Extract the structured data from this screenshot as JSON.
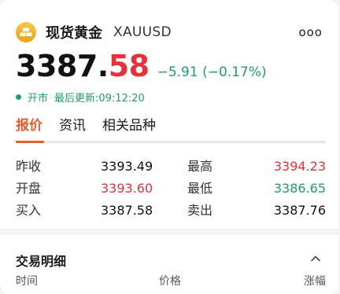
{
  "header": {
    "name": "现货黄金",
    "code": "XAUUSD",
    "more_label": "ooo",
    "icon": "gold-bar-icon"
  },
  "quote": {
    "price_int": "3387.",
    "price_dec": "58",
    "change": "−5.91 (−0.17%)"
  },
  "status": {
    "state": "开市",
    "updated": "最后更新:09:12:20"
  },
  "tabs": [
    {
      "label": "报价"
    },
    {
      "label": "资讯"
    },
    {
      "label": "相关品种"
    }
  ],
  "stats": [
    {
      "label1": "昨收",
      "value1": "3393.49",
      "label2": "最高",
      "value2": "3394.23"
    },
    {
      "label1": "开盘",
      "value1": "3393.60",
      "label2": "最低",
      "value2": "3386.65"
    },
    {
      "label1": "买入",
      "value1": "3387.58",
      "label2": "卖出",
      "value2": "3387.76"
    }
  ],
  "trades": {
    "title": "交易明细",
    "columns": [
      "时间",
      "价格",
      "涨幅"
    ]
  },
  "colors": {
    "up": "#e5323a",
    "down": "#1f9d6b",
    "accent": "#e85d2b",
    "gold": "#f0b429"
  }
}
